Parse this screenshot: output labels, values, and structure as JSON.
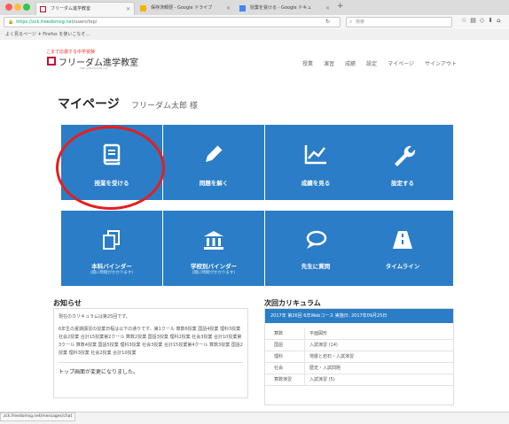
{
  "browser": {
    "tabs": [
      {
        "title": "フリーダム進学教室",
        "icon_color": "#c0122f"
      },
      {
        "title": "保存済郵便 - Google ドライブ",
        "icon_color": "#f4b400"
      },
      {
        "title": "授業を受ける - Google ドキュ",
        "icon_color": "#4285f4"
      }
    ],
    "url_host": "https://zck.freedomsg.net",
    "url_path": "/users/top/",
    "search_placeholder": "検索",
    "bookmarks_text": "よく見るページ  ✈ Firefox を使いこなそ..."
  },
  "site": {
    "tagline": "こまで応援する中学受験",
    "logo_text": "フリーダム進学教室",
    "logo_url": "http://freedomsg.net",
    "nav": [
      "授業",
      "演習",
      "成績",
      "設定",
      "マイページ",
      "サインアウト"
    ]
  },
  "page": {
    "title": "マイページ",
    "user": "フリーダム太郎 様"
  },
  "tiles": [
    {
      "label": "授業を受ける",
      "sub": "",
      "icon": "book-icon"
    },
    {
      "label": "問題を解く",
      "sub": "",
      "icon": "pencil-icon"
    },
    {
      "label": "成績を見る",
      "sub": "",
      "icon": "line-chart-icon"
    },
    {
      "label": "設定する",
      "sub": "",
      "icon": "wrench-icon"
    },
    {
      "label": "本科バインダー",
      "sub": "(開に時間がかかります)",
      "icon": "copy-icon"
    },
    {
      "label": "学校別バインダー",
      "sub": "(開に時間がかかります)",
      "icon": "bank-icon"
    },
    {
      "label": "先生に質問",
      "sub": "",
      "icon": "chat-icon"
    },
    {
      "label": "タイムライン",
      "sub": "",
      "icon": "road-icon"
    }
  ],
  "notice": {
    "title": "お知らせ",
    "line1": "現在のカリキュラムは第25回です。",
    "body": "6年生の夏期講習の授業日程は以下の通りです。第1クール 算数6授業 国語4授業 理科3授業 社会2授業 合計15授業第2クール 算数2授業 国語3授業 理科2授業 社会3授業 合計10授業第3クール 算数4授業 国語5授業 理科3授業 社会3授業 合計15授業第4クール 算数3授業 国語2授業 理科3授業 社会2授業 合計10授業",
    "item2": "トップ画面が変更になりました。"
  },
  "curriculum": {
    "title": "次回カリキュラム",
    "header": "2017年 第26回 6年Webコース  実施日: 2017年09月25日",
    "rows": [
      {
        "subject": "算数",
        "content": "平面図形"
      },
      {
        "subject": "国語",
        "content": "入試演習 (14)"
      },
      {
        "subject": "理科",
        "content": "地層と岩石・入試演習"
      },
      {
        "subject": "社会",
        "content": "歴史・入試問題"
      },
      {
        "subject": "算数演習",
        "content": "入試演習 (5)"
      }
    ]
  },
  "status_url": "zck.freedomsg.net/messages/chat",
  "colors": {
    "tile": "#2a7dc6",
    "highlight_circle": "#e51f1f",
    "brand": "#c0122f"
  }
}
